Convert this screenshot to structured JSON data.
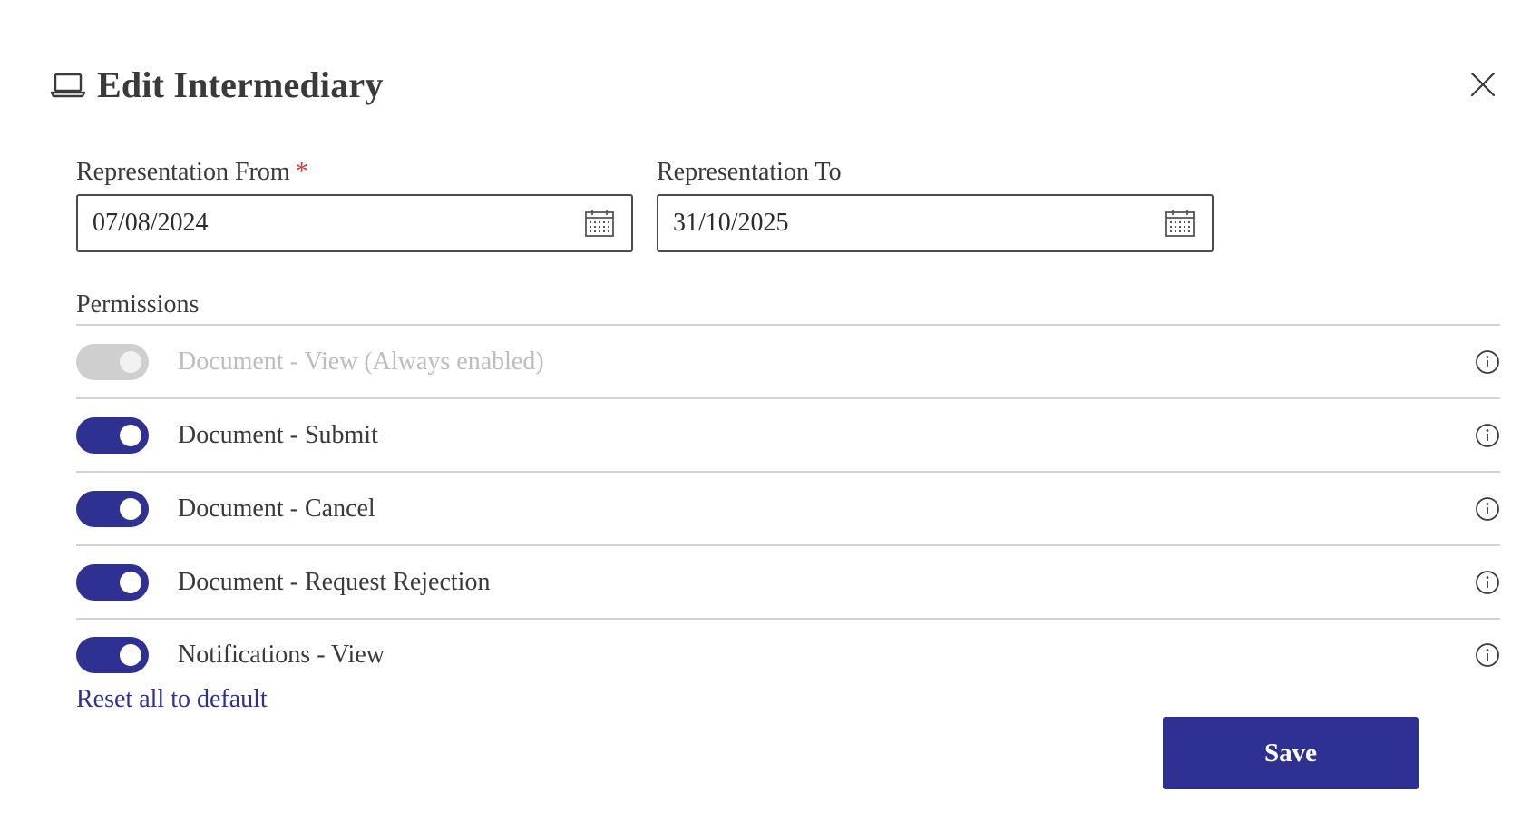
{
  "dialog": {
    "title": "Edit Intermediary",
    "title_icon": "laptop-icon",
    "close_icon": "close-icon"
  },
  "representation_from": {
    "label": "Representation From",
    "required_marker": "*",
    "value": "07/08/2024",
    "icon": "calendar-icon"
  },
  "representation_to": {
    "label": "Representation To",
    "value": "31/10/2025",
    "icon": "calendar-icon"
  },
  "permissions": {
    "label": "Permissions",
    "items": [
      {
        "label": "Document - View (Always enabled)",
        "enabled": true,
        "disabled": true
      },
      {
        "label": "Document - Submit",
        "enabled": true,
        "disabled": false
      },
      {
        "label": "Document - Cancel",
        "enabled": true,
        "disabled": false
      },
      {
        "label": "Document - Request Rejection",
        "enabled": true,
        "disabled": false
      },
      {
        "label": "Notifications - View",
        "enabled": true,
        "disabled": false
      }
    ]
  },
  "actions": {
    "reset_label": "Reset all to default",
    "save_label": "Save"
  },
  "colors": {
    "accent": "#2e3192",
    "required": "#d23c3c",
    "disabled_toggle": "#cfcfcf",
    "text": "#3a3a3a"
  }
}
